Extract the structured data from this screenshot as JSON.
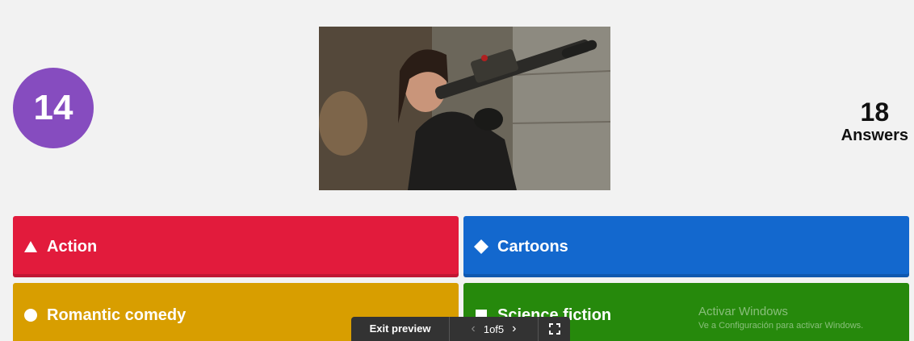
{
  "question": {
    "timer": "14",
    "answers_count": "18",
    "answers_label": "Answers"
  },
  "options": [
    {
      "label": "Action",
      "icon": "triangle-icon",
      "color": "#e21b3c"
    },
    {
      "label": "Cartoons",
      "icon": "diamond-icon",
      "color": "#1368ce"
    },
    {
      "label": "Romantic comedy",
      "icon": "circle-icon",
      "color": "#d89e00"
    },
    {
      "label": "Science fiction",
      "icon": "square-icon",
      "color": "#26890c"
    }
  ],
  "colors": {
    "timer_bg": "#864cbf",
    "background": "#f2f2f2",
    "toolbar_bg": "#333333"
  },
  "watermark": {
    "line1": "Activar Windows",
    "line2": "Ve a Configuración para activar Windows."
  },
  "toolbar": {
    "exit_label": "Exit preview",
    "page_indicator": "1of5",
    "prev_icon": "chevron-left-icon",
    "next_icon": "chevron-right-icon",
    "fullscreen_icon": "fullscreen-icon"
  }
}
